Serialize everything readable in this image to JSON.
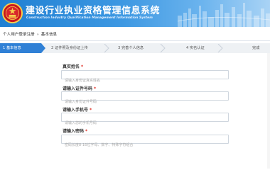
{
  "header": {
    "title": "建设行业执业资格管理信息系统",
    "subtitle": "Construction Industry Qualification Management Information System"
  },
  "breadcrumb": {
    "items": [
      "个人用户登录注册",
      "基本信息"
    ],
    "separator": "»"
  },
  "steps": [
    {
      "label": "1 基本信息",
      "active": true
    },
    {
      "label": "2 证件照及身份证上传",
      "active": false
    },
    {
      "label": "3 完善个人信息",
      "active": false
    },
    {
      "label": "4 实名认证",
      "active": false
    },
    {
      "label": "完成",
      "active": false
    }
  ],
  "form": {
    "fields": [
      {
        "label": "真实姓名",
        "required": "*",
        "placeholder": "请输入身份证真实姓名",
        "value": ""
      },
      {
        "label": "请输入证件号码",
        "required": "*",
        "placeholder": "请输入身份证件号码",
        "value": ""
      },
      {
        "label": "请输入手机号",
        "required": "*",
        "placeholder": "请输入您的手机号码",
        "value": ""
      },
      {
        "label": "请输入密码",
        "required": "*",
        "placeholder": "密码长度8-16位字母、数字、特殊字符组合",
        "value": ""
      }
    ]
  },
  "colors": {
    "header_blue": "#1f7fd2",
    "active_step": "#2f80d6",
    "required_red": "#e0281e"
  },
  "icons": {
    "emblem": "national-emblem-icon"
  }
}
